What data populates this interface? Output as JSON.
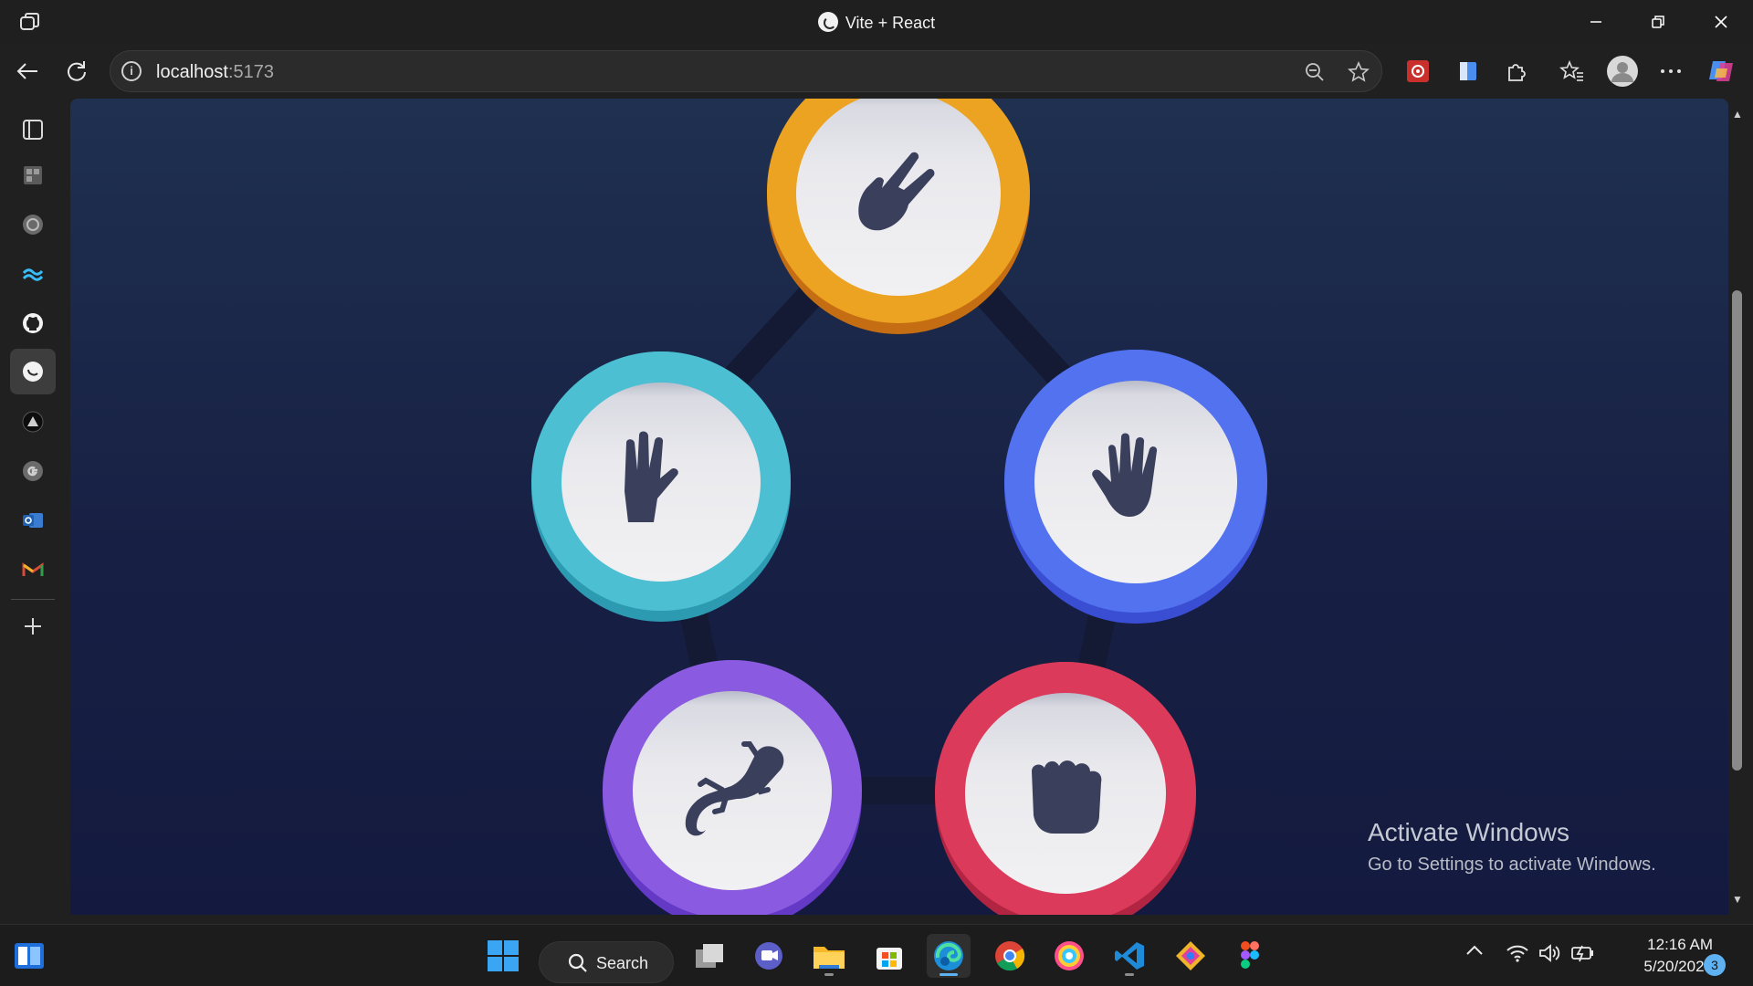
{
  "window": {
    "tab_title": "Vite + React",
    "controls": [
      "minimize-icon",
      "restore-icon",
      "close-icon"
    ]
  },
  "address_bar": {
    "host": "localhost",
    "port": ":5173"
  },
  "sidebar": {
    "items": [
      "tabs-icon",
      "apps-icon",
      "openai-icon",
      "tailwind-icon",
      "github-icon",
      "vite-react-icon",
      "vercel-icon",
      "google-icon",
      "outlook-icon",
      "gmail-icon"
    ],
    "add_icon": "plus-icon"
  },
  "game": {
    "tokens": [
      {
        "name": "scissors",
        "color": "#eca321",
        "shadow": "#c2690f",
        "icon": "scissors-hand-icon"
      },
      {
        "name": "spock",
        "color": "#4cbfd3",
        "shadow": "#2c9bb1",
        "icon": "spock-hand-icon"
      },
      {
        "name": "paper",
        "color": "#5272f0",
        "shadow": "#3a4ed4",
        "icon": "paper-hand-icon"
      },
      {
        "name": "lizard",
        "color": "#8a5ae0",
        "shadow": "#6339c5",
        "icon": "lizard-icon"
      },
      {
        "name": "rock",
        "color": "#dc3a5b",
        "shadow": "#b12543",
        "icon": "rock-fist-icon"
      }
    ]
  },
  "watermark": {
    "heading": "Activate Windows",
    "subtext": "Go to Settings to activate Windows."
  },
  "taskbar": {
    "search_label": "Search",
    "time": "12:16 AM",
    "date": "5/20/2025",
    "notification_count": "3"
  }
}
